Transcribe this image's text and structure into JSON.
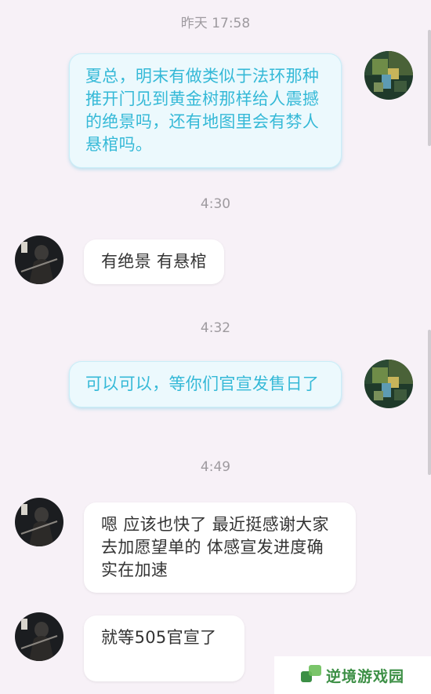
{
  "chat": {
    "messages": [
      {
        "timestamp": "昨天 17:58",
        "direction": "outgoing",
        "text": "夏总，明末有做类似于法环那种推开门见到黄金树那样给人震撼的绝景吗，还有地图里会有棼人悬棺吗。"
      },
      {
        "timestamp": "4:30",
        "direction": "incoming",
        "text": "有绝景 有悬棺"
      },
      {
        "timestamp": "4:32",
        "direction": "outgoing",
        "text": "可以可以，等你们官宣发售日了"
      },
      {
        "timestamp": "4:49",
        "direction": "incoming",
        "text": "嗯 应该也快了 最近挺感谢大家去加愿望单的  体感宣发进度确实在加速"
      },
      {
        "timestamp": "",
        "direction": "incoming",
        "text": "就等505官宣了"
      }
    ]
  },
  "watermark": {
    "text": "逆境游戏园"
  },
  "colors": {
    "background": "#f7f1f7",
    "outgoing_bubble": "#ecf9fd",
    "outgoing_text": "#35b9d7",
    "incoming_bubble": "#ffffff",
    "incoming_text": "#333333",
    "timestamp": "#9e9a9f",
    "watermark": "#3c8f45"
  }
}
